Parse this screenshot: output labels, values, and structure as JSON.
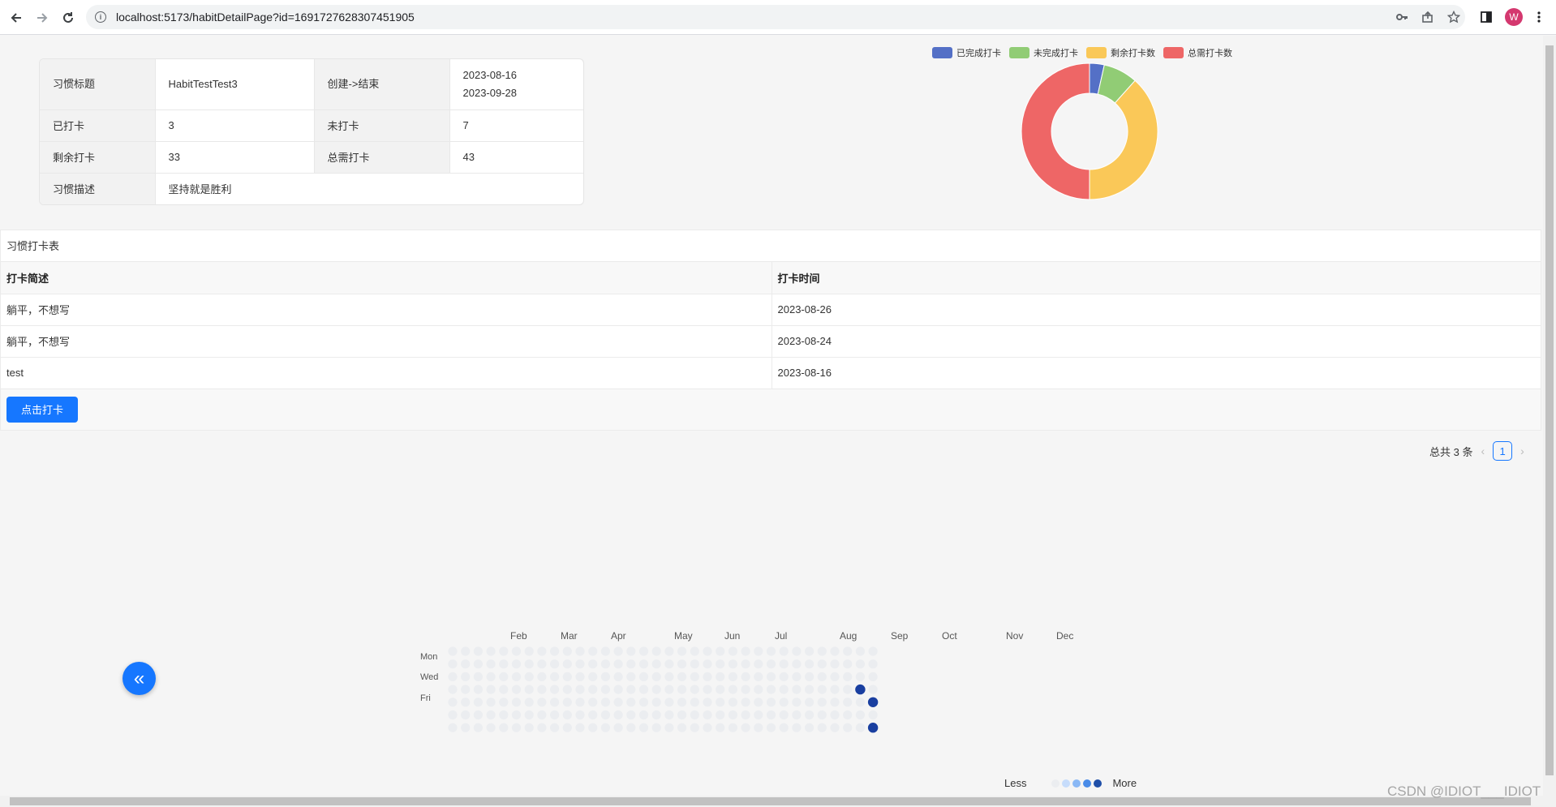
{
  "browser": {
    "url": "localhost:5173/habitDetailPage?id=1691727628307451905",
    "profile_initial": "W"
  },
  "details": {
    "title_label": "习惯标题",
    "title_value": "HabitTestTest3",
    "range_label": "创建->结束",
    "start_date": "2023-08-16",
    "end_date": "2023-09-28",
    "done_label": "已打卡",
    "done_value": "3",
    "undone_label": "未打卡",
    "undone_value": "7",
    "remaining_label": "剩余打卡",
    "remaining_value": "33",
    "total_label": "总需打卡",
    "total_value": "43",
    "desc_label": "习惯描述",
    "desc_value": "坚持就是胜利"
  },
  "chart_data": {
    "type": "pie",
    "variant": "donut",
    "categories": [
      "已完成打卡",
      "未完成打卡",
      "剩余打卡数",
      "总需打卡数"
    ],
    "values": [
      3,
      7,
      33,
      43
    ],
    "colors": [
      "#5470c6",
      "#91cc75",
      "#fac858",
      "#ee6666"
    ],
    "legend_position": "top"
  },
  "records": {
    "title": "习惯打卡表",
    "headers": [
      "打卡简述",
      "打卡时间"
    ],
    "rows": [
      [
        "躺平，不想写",
        "2023-08-26"
      ],
      [
        "躺平，不想写",
        "2023-08-24"
      ],
      [
        "test",
        "2023-08-16"
      ]
    ],
    "checkin_button": "点击打卡"
  },
  "pagination": {
    "total_text": "总共 3 条",
    "current_page": "1"
  },
  "heatmap": {
    "months": [
      "Feb",
      "Mar",
      "Apr",
      "May",
      "Jun",
      "Jul",
      "Aug",
      "Sep",
      "Oct",
      "Nov",
      "Dec"
    ],
    "day_labels": [
      "Mon",
      "Wed",
      "Fri"
    ],
    "legend_less": "Less",
    "legend_more": "More",
    "empty_color": "#ebedf0",
    "level_colors": [
      "#ebedf0",
      "#c6dcfb",
      "#8ab8f5",
      "#4a8ce8",
      "#1f4fa8"
    ],
    "filled_color": "#1a3fa0",
    "checkin_dates": [
      "2023-08-16",
      "2023-08-24",
      "2023-08-26"
    ]
  },
  "fab_icon": "double-chevron-left-icon",
  "watermark": "CSDN @IDIOT___IDIOT"
}
